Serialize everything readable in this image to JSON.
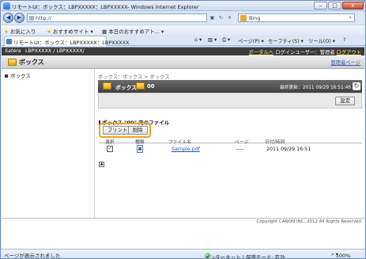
{
  "window": {
    "title": "リモートUI：ボックス：LBPXXXXX：LBPXXXXX- Windows Internet Explorer",
    "min": "–",
    "max": "□",
    "close": "x"
  },
  "addressbar": {
    "url": "http://",
    "search_value": "Bing",
    "back": "◀",
    "forward": "▶"
  },
  "favbar": {
    "favorites": "お気に入り",
    "recommended": "おすすめサイト ▾",
    "today": "本日のおすすめアト... ▾"
  },
  "tabbar": {
    "tab_label": "リモートUI：ボックス：LBPXXXXX：LBPXXXXX",
    "commands": [
      "ページ(P) ▾",
      "セーフティ(S) ▾",
      "ツール(O) ▾",
      "?"
    ]
  },
  "remoteui": {
    "brand": "Satera",
    "model": "LBPXXXXX / LBPXXXXX/",
    "portal_link": "ポータルへ",
    "login_user": "ログインユーザー：管理者",
    "logout": "ログアウト",
    "section_title": "ボックス",
    "mgr_mode": "管理者ページ",
    "sidebar_item": "ボックス",
    "breadcrumb": "ボックス：ボックス > ボックス",
    "header_box": "ボックス",
    "header_num": "00",
    "updated": "最終更新：2011 09/29 16:51:46",
    "settings_button": "設定",
    "files_section": "ボックス \"00\" 内のファイル",
    "print_button": "プリント",
    "delete_button": "削除",
    "table": {
      "columns": [
        "選択",
        "種類",
        "ファイル名",
        "ページ",
        "日付/時刻"
      ],
      "rows": [
        {
          "file": "Sample.pdf",
          "pages": "----",
          "datetime": "2011 09/29 16:51"
        }
      ]
    },
    "copyright": "Copyright CANON INC. 2012 All Rights Reserved"
  },
  "statusbar": {
    "left": "ページが表示されました",
    "zone": "インターネット | 保護モード: 有効",
    "zoom": "100%"
  }
}
